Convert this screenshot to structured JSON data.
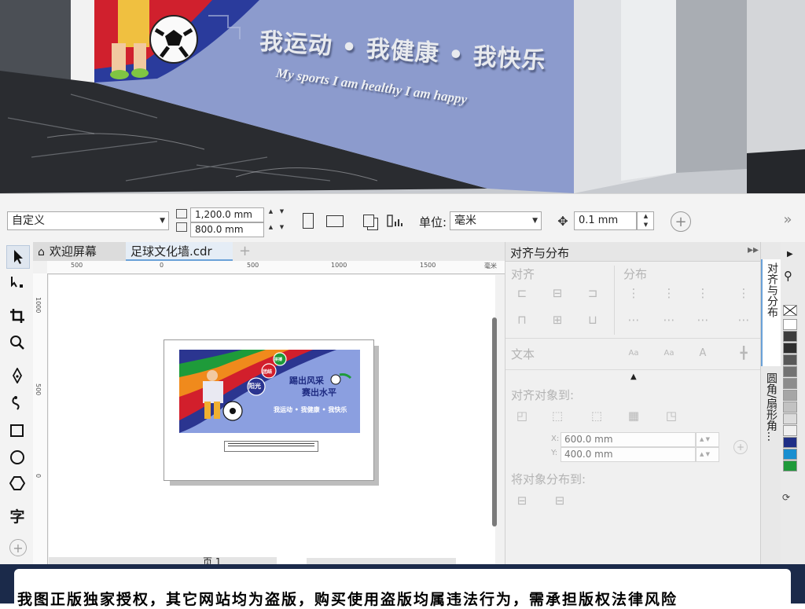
{
  "scene": {
    "slogan": "我运动 • 我健康 • 我快乐",
    "slogan_en": "My sports I am healthy  I am happy"
  },
  "property_bar": {
    "preset": "自定义",
    "width": "1,200.0 mm",
    "height": "800.0 mm",
    "units_label": "单位:",
    "units_value": "毫米",
    "nudge": "0.1 mm"
  },
  "tabs": {
    "welcome": "欢迎屏幕",
    "document": "足球文化墙.cdr",
    "add": "+"
  },
  "ruler": {
    "h_ticks": [
      "500",
      "0",
      "500",
      "1000",
      "1500"
    ],
    "h_unit": "毫米",
    "v_ticks": [
      "1000",
      "500",
      "0"
    ]
  },
  "artwork": {
    "bubble_1": "阳光",
    "bubble_2": "团结",
    "bubble_3": "拼搏",
    "headline_1": "踢出风采",
    "headline_2": "赛出水平",
    "slogan": "我运动 • 我健康 • 我快乐"
  },
  "docker": {
    "title": "对齐与分布",
    "align_section": "对齐",
    "distribute_section": "分布",
    "text_section": "文本",
    "align_to_label": "对齐对象到:",
    "x_label": "X:",
    "x_value": "600.0 mm",
    "y_label": "Y:",
    "y_value": "400.0 mm",
    "distribute_to_label": "将对象分布到:"
  },
  "vtabs": {
    "tab1": "对齐与分布",
    "tab2": "圆角/扇形角..."
  },
  "status": {
    "page_label": "页 1"
  },
  "palette": {
    "colors": [
      "#ffffff",
      "#3d3d3d",
      "#2f2f2f",
      "#595959",
      "#737373",
      "#8c8c8c",
      "#a6a6a6",
      "#c2c2c2",
      "#dcdcdc",
      "#f0f0f0",
      "#1f2f86",
      "#1a8fd0",
      "#1f9a3a"
    ]
  },
  "banner": {
    "text": "我图正版独家授权，其它网站均为盗版，购买使用盗版均属违法行为，需承担版权法律风险"
  },
  "colors": {
    "accent": "#1f5fb8",
    "wall": "#8e9fcf",
    "red": "#c81e2b"
  }
}
